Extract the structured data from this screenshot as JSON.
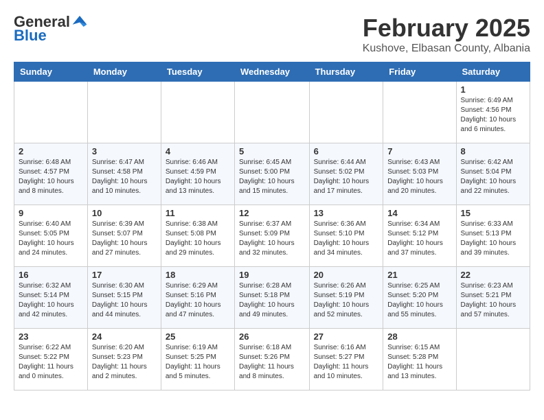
{
  "logo": {
    "general": "General",
    "blue": "Blue"
  },
  "title": "February 2025",
  "location": "Kushove, Elbasan County, Albania",
  "weekdays": [
    "Sunday",
    "Monday",
    "Tuesday",
    "Wednesday",
    "Thursday",
    "Friday",
    "Saturday"
  ],
  "weeks": [
    [
      {
        "day": "",
        "info": ""
      },
      {
        "day": "",
        "info": ""
      },
      {
        "day": "",
        "info": ""
      },
      {
        "day": "",
        "info": ""
      },
      {
        "day": "",
        "info": ""
      },
      {
        "day": "",
        "info": ""
      },
      {
        "day": "1",
        "info": "Sunrise: 6:49 AM\nSunset: 4:56 PM\nDaylight: 10 hours and 6 minutes."
      }
    ],
    [
      {
        "day": "2",
        "info": "Sunrise: 6:48 AM\nSunset: 4:57 PM\nDaylight: 10 hours and 8 minutes."
      },
      {
        "day": "3",
        "info": "Sunrise: 6:47 AM\nSunset: 4:58 PM\nDaylight: 10 hours and 10 minutes."
      },
      {
        "day": "4",
        "info": "Sunrise: 6:46 AM\nSunset: 4:59 PM\nDaylight: 10 hours and 13 minutes."
      },
      {
        "day": "5",
        "info": "Sunrise: 6:45 AM\nSunset: 5:00 PM\nDaylight: 10 hours and 15 minutes."
      },
      {
        "day": "6",
        "info": "Sunrise: 6:44 AM\nSunset: 5:02 PM\nDaylight: 10 hours and 17 minutes."
      },
      {
        "day": "7",
        "info": "Sunrise: 6:43 AM\nSunset: 5:03 PM\nDaylight: 10 hours and 20 minutes."
      },
      {
        "day": "8",
        "info": "Sunrise: 6:42 AM\nSunset: 5:04 PM\nDaylight: 10 hours and 22 minutes."
      }
    ],
    [
      {
        "day": "9",
        "info": "Sunrise: 6:40 AM\nSunset: 5:05 PM\nDaylight: 10 hours and 24 minutes."
      },
      {
        "day": "10",
        "info": "Sunrise: 6:39 AM\nSunset: 5:07 PM\nDaylight: 10 hours and 27 minutes."
      },
      {
        "day": "11",
        "info": "Sunrise: 6:38 AM\nSunset: 5:08 PM\nDaylight: 10 hours and 29 minutes."
      },
      {
        "day": "12",
        "info": "Sunrise: 6:37 AM\nSunset: 5:09 PM\nDaylight: 10 hours and 32 minutes."
      },
      {
        "day": "13",
        "info": "Sunrise: 6:36 AM\nSunset: 5:10 PM\nDaylight: 10 hours and 34 minutes."
      },
      {
        "day": "14",
        "info": "Sunrise: 6:34 AM\nSunset: 5:12 PM\nDaylight: 10 hours and 37 minutes."
      },
      {
        "day": "15",
        "info": "Sunrise: 6:33 AM\nSunset: 5:13 PM\nDaylight: 10 hours and 39 minutes."
      }
    ],
    [
      {
        "day": "16",
        "info": "Sunrise: 6:32 AM\nSunset: 5:14 PM\nDaylight: 10 hours and 42 minutes."
      },
      {
        "day": "17",
        "info": "Sunrise: 6:30 AM\nSunset: 5:15 PM\nDaylight: 10 hours and 44 minutes."
      },
      {
        "day": "18",
        "info": "Sunrise: 6:29 AM\nSunset: 5:16 PM\nDaylight: 10 hours and 47 minutes."
      },
      {
        "day": "19",
        "info": "Sunrise: 6:28 AM\nSunset: 5:18 PM\nDaylight: 10 hours and 49 minutes."
      },
      {
        "day": "20",
        "info": "Sunrise: 6:26 AM\nSunset: 5:19 PM\nDaylight: 10 hours and 52 minutes."
      },
      {
        "day": "21",
        "info": "Sunrise: 6:25 AM\nSunset: 5:20 PM\nDaylight: 10 hours and 55 minutes."
      },
      {
        "day": "22",
        "info": "Sunrise: 6:23 AM\nSunset: 5:21 PM\nDaylight: 10 hours and 57 minutes."
      }
    ],
    [
      {
        "day": "23",
        "info": "Sunrise: 6:22 AM\nSunset: 5:22 PM\nDaylight: 11 hours and 0 minutes."
      },
      {
        "day": "24",
        "info": "Sunrise: 6:20 AM\nSunset: 5:23 PM\nDaylight: 11 hours and 2 minutes."
      },
      {
        "day": "25",
        "info": "Sunrise: 6:19 AM\nSunset: 5:25 PM\nDaylight: 11 hours and 5 minutes."
      },
      {
        "day": "26",
        "info": "Sunrise: 6:18 AM\nSunset: 5:26 PM\nDaylight: 11 hours and 8 minutes."
      },
      {
        "day": "27",
        "info": "Sunrise: 6:16 AM\nSunset: 5:27 PM\nDaylight: 11 hours and 10 minutes."
      },
      {
        "day": "28",
        "info": "Sunrise: 6:15 AM\nSunset: 5:28 PM\nDaylight: 11 hours and 13 minutes."
      },
      {
        "day": "",
        "info": ""
      }
    ]
  ]
}
